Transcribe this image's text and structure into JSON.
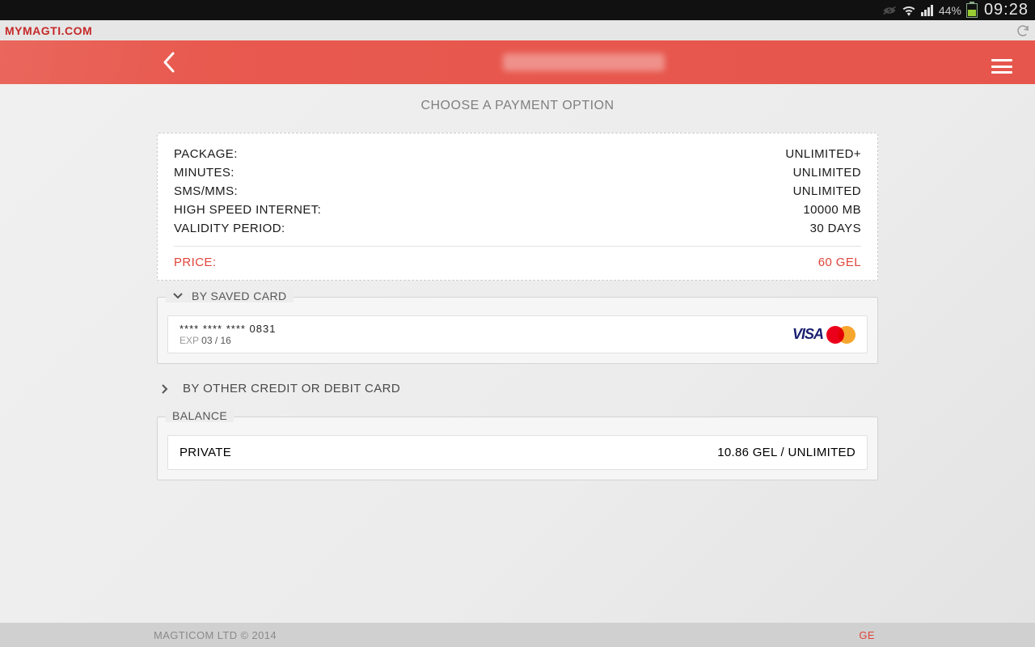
{
  "status": {
    "battery_pct": "44%",
    "clock": "09:28"
  },
  "urlbar": {
    "url": "MYMAGTI.COM"
  },
  "page": {
    "title": "CHOOSE A PAYMENT OPTION"
  },
  "receipt": {
    "rows": [
      {
        "label": "PACKAGE:",
        "value": "UNLIMITED+"
      },
      {
        "label": "MINUTES:",
        "value": "UNLIMITED"
      },
      {
        "label": "SMS/MMS:",
        "value": "UNLIMITED"
      },
      {
        "label": "HIGH SPEED INTERNET:",
        "value": "10000 MB"
      },
      {
        "label": "VALIDITY PERIOD:",
        "value": "30 DAYS"
      }
    ],
    "price_label": "PRICE:",
    "price_value": "60 GEL"
  },
  "saved_card": {
    "section_label": "BY SAVED CARD",
    "masked_number": "**** **** **** 0831",
    "exp_label": "EXP",
    "exp_value": "03 / 16"
  },
  "other_card": {
    "label": "BY OTHER CREDIT OR DEBIT CARD"
  },
  "balance": {
    "section_label": "BALANCE",
    "type": "PRIVATE",
    "value": "10.86 GEL / UNLIMITED"
  },
  "footer": {
    "copyright": "MAGTICOM LTD © 2014",
    "lang": "GE"
  }
}
